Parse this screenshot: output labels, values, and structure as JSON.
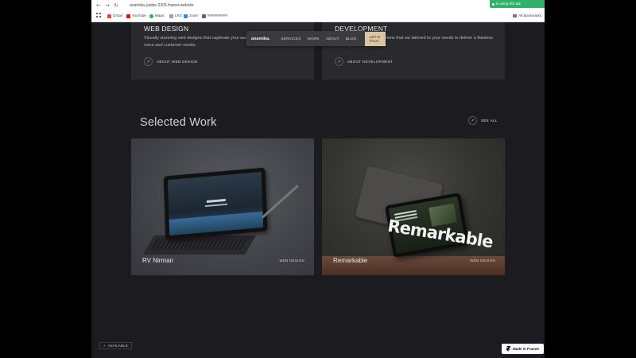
{
  "browser": {
    "url": "anamika-yadav-2305.framer.website",
    "nav": {
      "back": "←",
      "forward": "→",
      "reload": "↻"
    },
    "bookmarks": [
      {
        "label": "Gmail",
        "color": "#ea4335"
      },
      {
        "label": "YouTube",
        "color": "#ff0000"
      },
      {
        "label": "Maps",
        "color": "#34a853"
      },
      {
        "label": "LRS",
        "color": "#9aa0a6"
      },
      {
        "label": "zoom",
        "color": "#2d8cff"
      },
      {
        "label": "##########",
        "color": "#5f6368"
      }
    ],
    "all_bookmarks": "All Bookmarks",
    "share_banner": "is using this tab"
  },
  "navbar": {
    "logo": "anamika.",
    "links": [
      "SERVICES",
      "WORK",
      "ABOUT",
      "BLOG"
    ],
    "cta": "LET'S TALK"
  },
  "services": [
    {
      "title": "WEB DESIGN",
      "desc": "Visually stunning web designs that captivate your audience by blending your brand voice and customer needs.",
      "link": "ABOUT WEB DESIGN"
    },
    {
      "title": "DEVELOPMENT",
      "desc": "Efficient development solutions that we tailored to your needs to deliver a flawless user experience.",
      "link": "ABOUT DEVELOPMENT"
    }
  ],
  "selected_work": {
    "title": "Selected Work",
    "see_all": "SEE ALL",
    "items": [
      {
        "name": "RV Nirman",
        "tag": "WEB DESIGN"
      },
      {
        "name": "Remarkable",
        "tag": "WEB DESIGN",
        "mockup_text": "Remarkable"
      }
    ]
  },
  "badges": {
    "available": "AVAILABLE",
    "made_in_framer": "Made in Framer"
  }
}
